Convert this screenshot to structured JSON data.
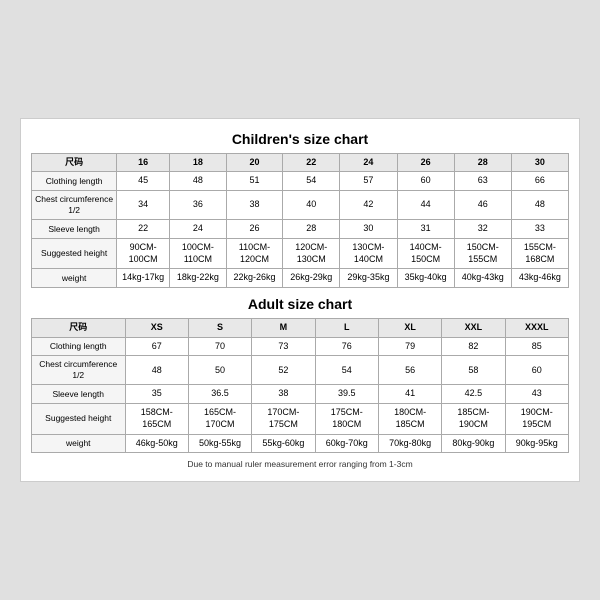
{
  "children_chart": {
    "title": "Children's size chart",
    "headers": [
      "尺码",
      "16",
      "18",
      "20",
      "22",
      "24",
      "26",
      "28",
      "30"
    ],
    "rows": [
      {
        "label": "Clothing length",
        "values": [
          "45",
          "48",
          "51",
          "54",
          "57",
          "60",
          "63",
          "66"
        ]
      },
      {
        "label": "Chest circumference 1/2",
        "values": [
          "34",
          "36",
          "38",
          "40",
          "42",
          "44",
          "46",
          "48"
        ]
      },
      {
        "label": "Sleeve length",
        "values": [
          "22",
          "24",
          "26",
          "28",
          "30",
          "31",
          "32",
          "33"
        ]
      },
      {
        "label": "Suggested height",
        "values": [
          "90CM-100CM",
          "100CM-110CM",
          "110CM-120CM",
          "120CM-130CM",
          "130CM-140CM",
          "140CM-150CM",
          "150CM-155CM",
          "155CM-168CM"
        ]
      },
      {
        "label": "weight",
        "values": [
          "14kg-17kg",
          "18kg-22kg",
          "22kg-26kg",
          "26kg-29kg",
          "29kg-35kg",
          "35kg-40kg",
          "40kg-43kg",
          "43kg-46kg"
        ]
      }
    ]
  },
  "adult_chart": {
    "title": "Adult size chart",
    "headers": [
      "尺码",
      "XS",
      "S",
      "M",
      "L",
      "XL",
      "XXL",
      "XXXL"
    ],
    "rows": [
      {
        "label": "Clothing length",
        "values": [
          "67",
          "70",
          "73",
          "76",
          "79",
          "82",
          "85"
        ]
      },
      {
        "label": "Chest circumference 1/2",
        "values": [
          "48",
          "50",
          "52",
          "54",
          "56",
          "58",
          "60"
        ]
      },
      {
        "label": "Sleeve length",
        "values": [
          "35",
          "36.5",
          "38",
          "39.5",
          "41",
          "42.5",
          "43"
        ]
      },
      {
        "label": "Suggested height",
        "values": [
          "158CM-165CM",
          "165CM-170CM",
          "170CM-175CM",
          "175CM-180CM",
          "180CM-185CM",
          "185CM-190CM",
          "190CM-195CM"
        ]
      },
      {
        "label": "weight",
        "values": [
          "46kg-50kg",
          "50kg-55kg",
          "55kg-60kg",
          "60kg-70kg",
          "70kg-80kg",
          "80kg-90kg",
          "90kg-95kg"
        ]
      }
    ]
  },
  "note": "Due to manual ruler measurement error ranging from 1-3cm"
}
